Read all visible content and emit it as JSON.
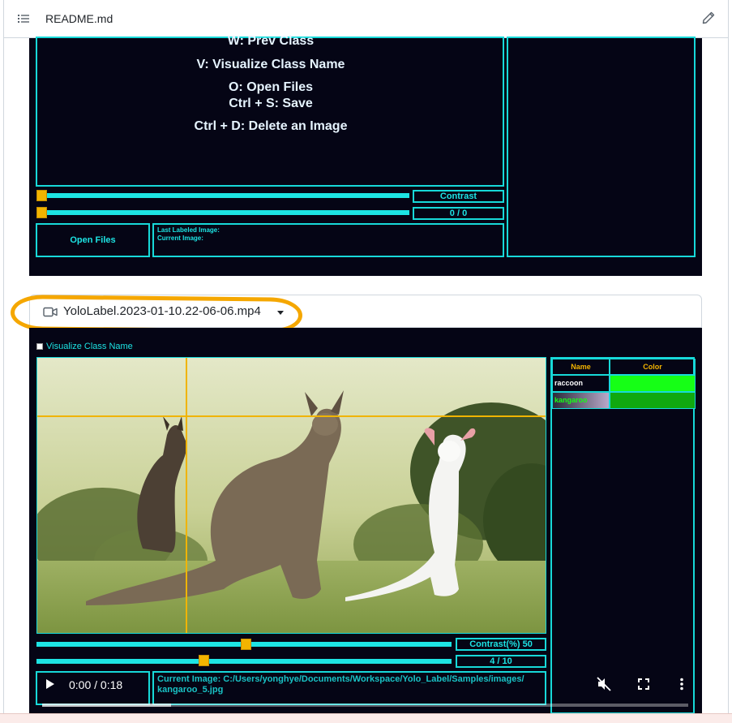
{
  "header": {
    "file_title": "README.md"
  },
  "panel1": {
    "shortcuts": [
      "W: Prev Class",
      "V: Visualize Class Name",
      "O: Open Files",
      "Ctrl + S: Save",
      "Ctrl + D: Delete an Image"
    ],
    "contrast_label": "Contrast",
    "counter_label": "0 / 0",
    "open_files_label": "Open Files",
    "last_labeled": "Last Labeled Image:",
    "current_image": "Current Image:"
  },
  "video": {
    "filename": "YoloLabel.2023-01-10.22-06-06.mp4",
    "visualize_label": "Visualize Class Name",
    "contrast_label": "Contrast(%) 50",
    "counter_label": "4 / 10",
    "current_image_path": "Current Image: C:/Users/yonghye/Documents/Workspace/Yolo_Label/Samples/images/ kangaroo_5.jpg",
    "time": "0:00 / 0:18",
    "progress_fraction": 0.2
  },
  "class_table": {
    "headers": [
      "Name",
      "Color"
    ],
    "rows": [
      {
        "name": "raccoon",
        "color": "#16ff16"
      },
      {
        "name": "kangaroo",
        "color": "#10a90f"
      }
    ]
  },
  "colors": {
    "accent_cyan": "#1de4e4",
    "slider_thumb": "#f3b400",
    "highlight_orange": "#f5a700",
    "panel_bg": "#050515"
  }
}
